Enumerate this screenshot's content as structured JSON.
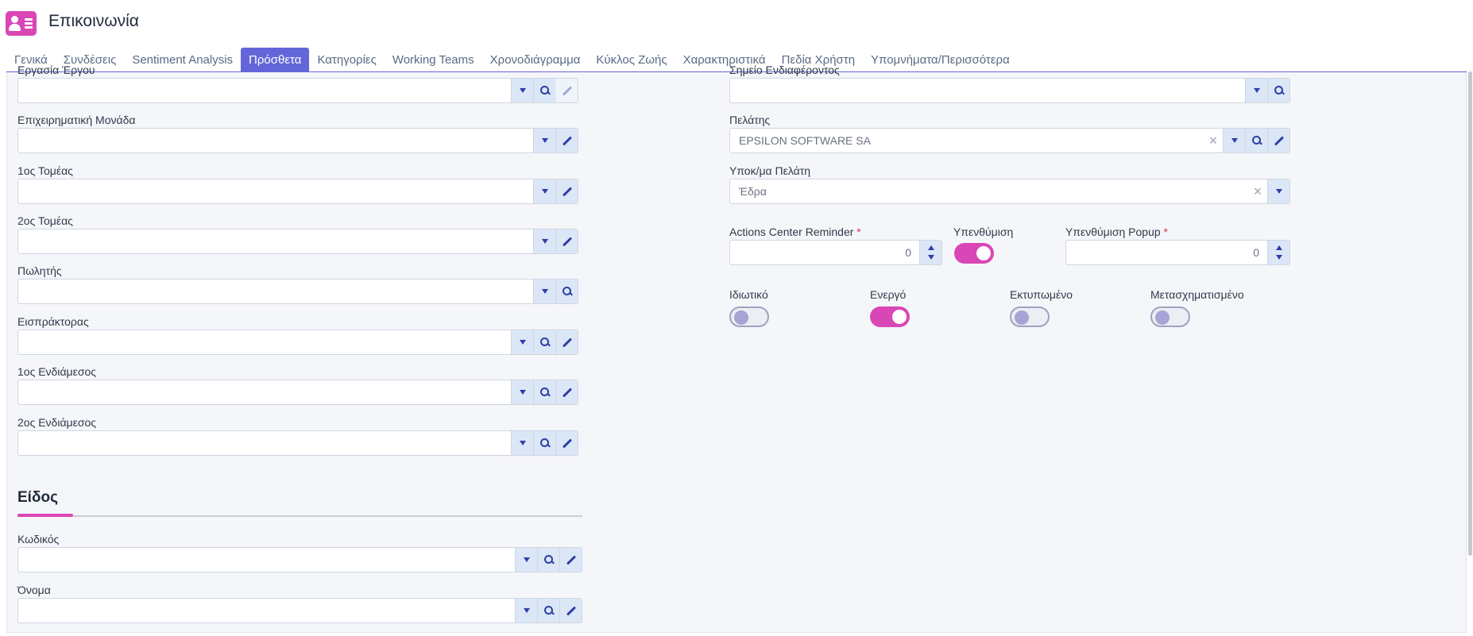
{
  "header": {
    "title": "Επικοινωνία",
    "icon": "contact-card-icon"
  },
  "tabs": [
    {
      "label": "Γενικά",
      "active": false
    },
    {
      "label": "Συνδέσεις",
      "active": false
    },
    {
      "label": "Sentiment Analysis",
      "active": false
    },
    {
      "label": "Πρόσθετα",
      "active": true
    },
    {
      "label": "Κατηγορίες",
      "active": false
    },
    {
      "label": "Working Teams",
      "active": false
    },
    {
      "label": "Χρονοδιάγραμμα",
      "active": false
    },
    {
      "label": "Κύκλος Ζωής",
      "active": false
    },
    {
      "label": "Χαρακτηριστικά",
      "active": false
    },
    {
      "label": "Πεδία Χρήστη",
      "active": false
    },
    {
      "label": "Υπομνήματα/Περισσότερα",
      "active": false
    }
  ],
  "left_fields": {
    "project_task": {
      "label": "Εργασία Έργου",
      "value": ""
    },
    "business_unit": {
      "label": "Επιχειρηματική Μονάδα",
      "value": ""
    },
    "sector1": {
      "label": "1ος Τομέας",
      "value": ""
    },
    "sector2": {
      "label": "2ος Τομέας",
      "value": ""
    },
    "salesman": {
      "label": "Πωλητής",
      "value": ""
    },
    "collector": {
      "label": "Εισπράκτορας",
      "value": ""
    },
    "intermediary1": {
      "label": "1ος Ενδιάμεσος",
      "value": ""
    },
    "intermediary2": {
      "label": "2ος Ενδιάμεσος",
      "value": ""
    }
  },
  "right_fields": {
    "point_of_interest": {
      "label": "Σημείο Ενδιαφέροντος",
      "value": ""
    },
    "customer": {
      "label": "Πελάτης",
      "value": "EPSILON SOFTWARE SA"
    },
    "customer_branch": {
      "label": "Υποκ/μα Πελάτη",
      "value": "Έδρα"
    }
  },
  "numbers": {
    "actions_center_reminder": {
      "label": "Actions Center Reminder",
      "required": "*",
      "value": "0"
    },
    "reminder_popup": {
      "label": "Υπενθύμιση Popup",
      "required": "*",
      "value": "0"
    }
  },
  "toggles": {
    "reminder": {
      "label": "Υπενθύμιση",
      "on": true
    },
    "private": {
      "label": "Ιδιωτικό",
      "on": false
    },
    "active": {
      "label": "Ενεργό",
      "on": true
    },
    "printed": {
      "label": "Εκτυπωμένο",
      "on": false
    },
    "converted": {
      "label": "Μετασχηματισμένο",
      "on": false
    }
  },
  "item_section": {
    "title": "Είδος",
    "code": {
      "label": "Κωδικός",
      "value": ""
    },
    "name": {
      "label": "Όνομα",
      "value": ""
    }
  },
  "colors": {
    "accent": "#d946b5",
    "tab_active": "#6366d9",
    "button_bg": "#dbe7f6",
    "icon": "#2d3fa6"
  }
}
